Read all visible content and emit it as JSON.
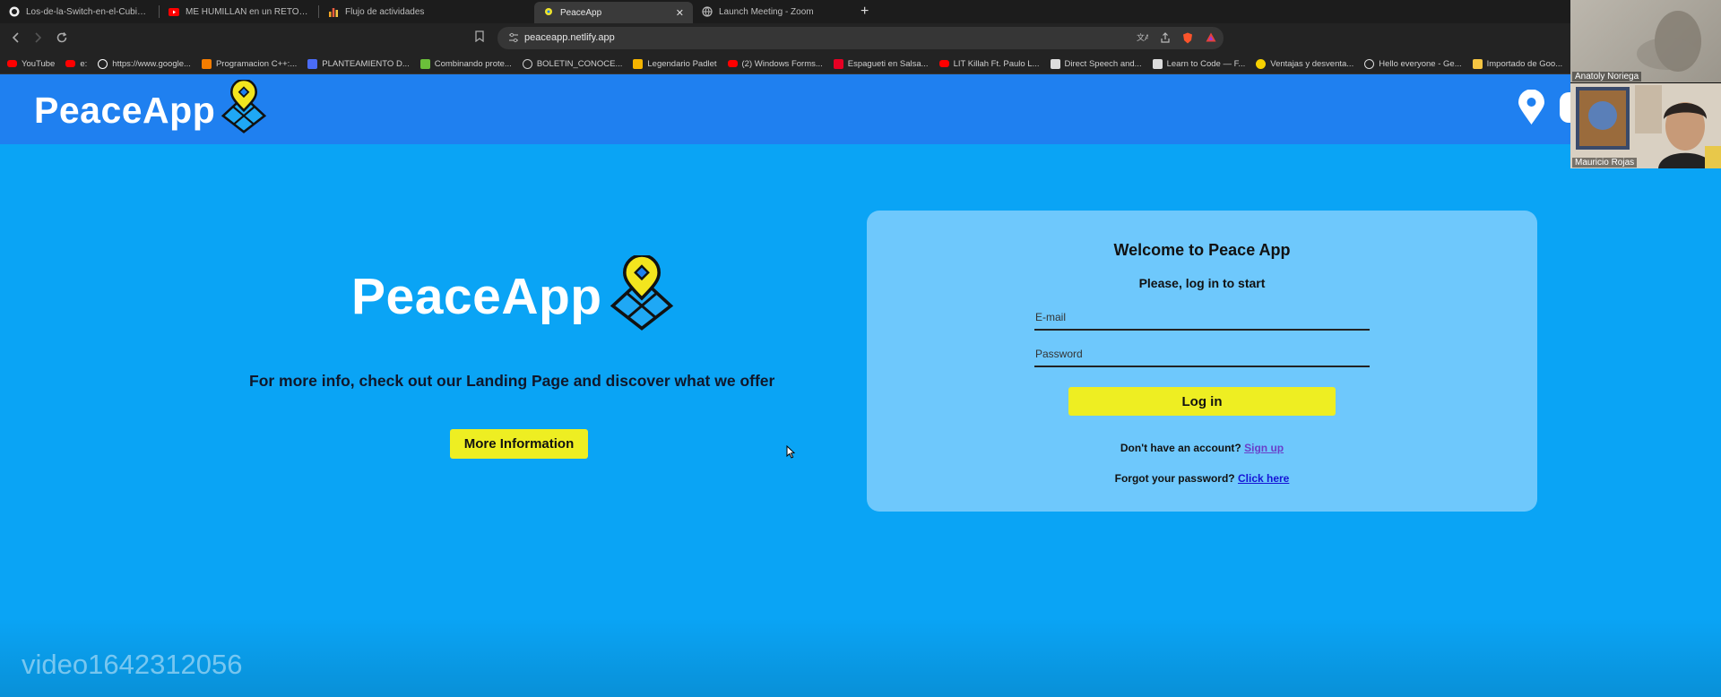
{
  "browser": {
    "tabs": [
      {
        "title": "Los-de-la-Switch-en-el-Cubiculo/PC",
        "icon": "github-icon",
        "active": false
      },
      {
        "title": "ME HUMILLAN en un RETO DE COM",
        "icon": "youtube-icon",
        "active": false
      },
      {
        "title": "Flujo de actividades",
        "icon": "chart-icon",
        "active": false
      },
      {
        "title": "PeaceApp",
        "icon": "peaceapp-icon",
        "active": true
      },
      {
        "title": "Launch Meeting - Zoom",
        "icon": "globe-icon",
        "active": false
      }
    ],
    "close_tab_glyph": "✕",
    "new_tab_glyph": "+",
    "address_bar": {
      "url": "peaceapp.netlify.app"
    },
    "bookmarks": [
      {
        "label": "YouTube",
        "icon": "youtube-icon",
        "color": "#ff0000"
      },
      {
        "label": "e:",
        "icon": "youtube-icon",
        "color": "#ff0000"
      },
      {
        "label": "https://www.google...",
        "icon": "google-icon",
        "color": "#ffffff"
      },
      {
        "label": "Programacion C++:...",
        "icon": "blogger-icon",
        "color": "#f57d00"
      },
      {
        "label": "PLANTEAMIENTO D...",
        "icon": "doc-icon",
        "color": "#4a6cf7"
      },
      {
        "label": "Combinando prote...",
        "icon": "leaf-icon",
        "color": "#6bbf3a"
      },
      {
        "label": "BOLETIN_CONOCE...",
        "icon": "globe-icon",
        "color": "#cccccc"
      },
      {
        "label": "Legendario Padlet",
        "icon": "padlet-icon",
        "color": "#f5b400"
      },
      {
        "label": "(2) Windows Forms...",
        "icon": "youtube-icon",
        "color": "#ff0000"
      },
      {
        "label": "Espagueti en Salsa...",
        "icon": "pinterest-icon",
        "color": "#e60023"
      },
      {
        "label": "LIT Killah Ft. Paulo L...",
        "icon": "youtube-icon",
        "color": "#ff0000"
      },
      {
        "label": "Direct Speech and...",
        "icon": "wave-icon",
        "color": "#dddddd"
      },
      {
        "label": "Learn to Code — F...",
        "icon": "freecodecamp-icon",
        "color": "#dddddd"
      },
      {
        "label": "Ventajas y desventa...",
        "icon": "sun-icon",
        "color": "#f5d000"
      },
      {
        "label": "Hello everyone - Ge...",
        "icon": "circle-icon",
        "color": "#dddddd"
      },
      {
        "label": "Importado de Goo...",
        "icon": "folder-icon",
        "color": "#f5c542"
      }
    ]
  },
  "header": {
    "brand": "PeaceApp",
    "colors": {
      "bar": "#1f80f0"
    }
  },
  "hero": {
    "brand": "PeaceApp",
    "text": "For more info, check out our Landing Page and discover what we offer",
    "button_label": "More Information"
  },
  "login": {
    "title": "Welcome to Peace App",
    "subtitle": "Please, log in to start",
    "email_placeholder": "E-mail",
    "email_value": "",
    "password_placeholder": "Password",
    "password_value": "",
    "button_label": "Log in",
    "signup_prompt": "Don't have an account?",
    "signup_link": "Sign up",
    "forgot_prompt": "Forgot your password?",
    "forgot_link": "Click here"
  },
  "colors": {
    "page_bg": "#0aa4f5",
    "card_bg": "#6ec8fc",
    "button_yellow": "#eeee22"
  },
  "zoom": {
    "participants": [
      {
        "name": "Anatoly Noriega"
      },
      {
        "name": "Mauricio Rojas"
      }
    ]
  },
  "watermark": "video1642312056"
}
